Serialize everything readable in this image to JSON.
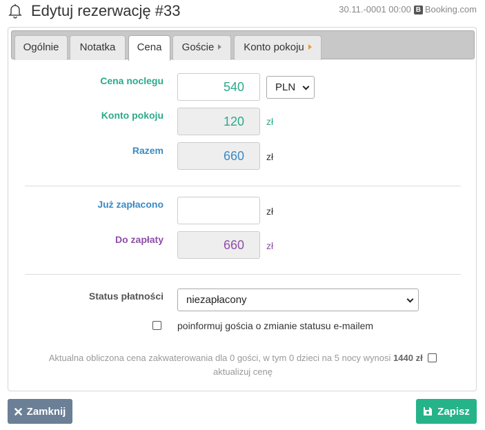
{
  "header": {
    "title": "Edytuj rezerwację #33",
    "date": "30.11.-0001 00:00",
    "source_badge": "B",
    "source": "Booking.com"
  },
  "tabs": [
    {
      "label": "Ogólnie",
      "active": false
    },
    {
      "label": "Notatka",
      "active": false
    },
    {
      "label": "Cena",
      "active": true
    },
    {
      "label": "Goście",
      "active": false
    },
    {
      "label": "Konto pokoju",
      "active": false
    }
  ],
  "form": {
    "night_price": {
      "label": "Cena noclegu",
      "value": "540",
      "currency": "PLN"
    },
    "room_account": {
      "label": "Konto pokoju",
      "value": "120",
      "unit": "zł"
    },
    "total": {
      "label": "Razem",
      "value": "660",
      "unit": "zł"
    },
    "paid": {
      "label": "Już zapłacono",
      "value": "",
      "unit": "zł"
    },
    "to_pay": {
      "label": "Do zapłaty",
      "value": "660",
      "unit": "zł"
    },
    "payment_status": {
      "label": "Status płatności",
      "value": "niezapłacony"
    },
    "notify_label": "poinformuj gościa o zmianie statusu e-mailem",
    "notify_checked": false
  },
  "note": {
    "text": "Aktualna obliczona cena zakwaterowania dla 0 gości, w tym 0 dzieci na 5 nocy wynosi",
    "amount": "1440 zł",
    "update_label": "aktualizuj cenę",
    "update_checked": false
  },
  "buttons": {
    "close": "Zamknij",
    "save": "Zapisz"
  },
  "colors": {
    "green": "#2aaa8a",
    "blue": "#3a8bc4",
    "purple": "#8e4fa8",
    "close_button": "#6b7f96",
    "save_button": "#26b38a"
  }
}
